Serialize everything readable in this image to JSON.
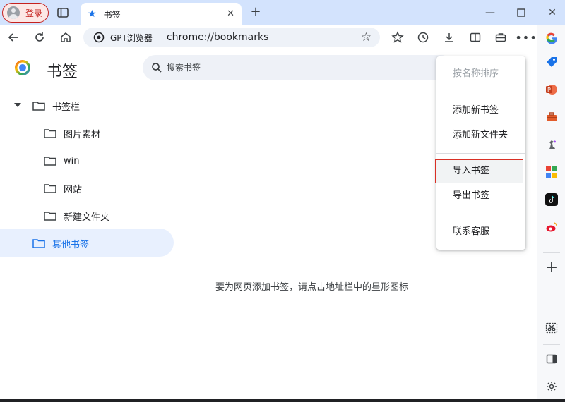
{
  "titlebar": {
    "login_label": "登录",
    "tab_title": "书签",
    "new_tab_symbol": "+",
    "window_controls": [
      "minimize-icon",
      "maximize-icon",
      "close-icon"
    ]
  },
  "toolbar": {
    "omnibox_app_label": "GPT浏览器",
    "url": "chrome://bookmarks",
    "icons": [
      "back-icon",
      "reload-icon",
      "home-icon",
      "extensions-icon",
      "history-icon",
      "downloads-icon",
      "reading-list-icon",
      "briefcase-icon",
      "more-icon",
      "google-icon"
    ]
  },
  "page": {
    "title": "书签",
    "search_placeholder": "搜索书签",
    "empty_message": "要为网页添加书签，请点击地址栏中的星形图标"
  },
  "tree": {
    "root": "书签栏",
    "children": [
      "图片素材",
      "win",
      "网站",
      "新建文件夹"
    ],
    "other": "其他书签"
  },
  "menu": {
    "sort_by_name": "按名称排序",
    "add_bookmark": "添加新书签",
    "add_folder": "添加新文件夹",
    "import_bookmarks": "导入书签",
    "export_bookmarks": "导出书签",
    "contact_support": "联系客服"
  },
  "right_sidebar": {
    "icons": [
      "google-icon",
      "tag-icon",
      "powerpoint-icon",
      "toolbox-icon",
      "chess-icon",
      "office-icon",
      "tiktok-icon",
      "weibo-icon",
      "add-icon",
      "scissors-icon",
      "panel-icon",
      "settings-icon"
    ]
  },
  "colors": {
    "accent": "#1a73e8",
    "login_red": "#c5221f",
    "highlight_border": "#d93025",
    "selected_bg": "#e8f0fe"
  }
}
